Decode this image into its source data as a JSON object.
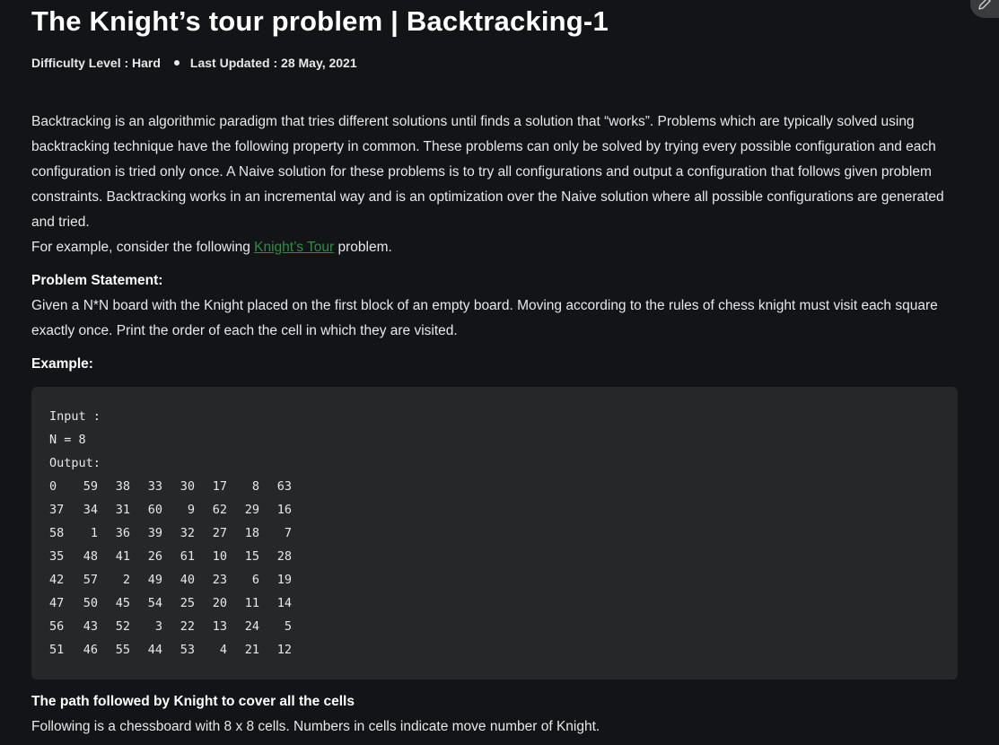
{
  "article": {
    "title": "The Knight’s tour problem | Backtracking-1",
    "difficulty_label": "Difficulty Level : Hard",
    "updated_label": "Last Updated : 28 May, 2021",
    "intro_paragraph": "Backtracking is an algorithmic paradigm that tries different solutions until finds a solution that “works”. Problems which are typically solved using backtracking technique have the following property in common. These problems can only be solved by trying every possible configuration and each configuration is tried only once. A Naive solution for these problems is to try all configurations and output a configuration that follows given problem constraints. Backtracking works in an incremental way and is an optimization over the Naive solution where all possible configurations are generated and tried.",
    "example_prefix": "For example, consider the following ",
    "example_link": "Knight’s Tour",
    "example_suffix": " problem.",
    "problem_heading": "Problem Statement:",
    "problem_text": "Given a N*N board with the Knight placed on the first block of an empty board. Moving according to the rules of chess knight must visit each square exactly once. Print the order of each the cell in which they are visited.",
    "example_heading": "Example:",
    "path_heading": "The path followed by Knight to cover all the cells",
    "path_text": "Following is a chessboard with 8 x 8 cells. Numbers in cells indicate move number of Knight."
  },
  "code": {
    "input_label": "Input :",
    "n_line": "N = 8",
    "output_label": "Output:",
    "board": [
      [
        "0",
        "59",
        "38",
        "33",
        "30",
        "17",
        "8",
        "63"
      ],
      [
        "37",
        "34",
        "31",
        "60",
        "9",
        "62",
        "29",
        "16"
      ],
      [
        "58",
        "1",
        "36",
        "39",
        "32",
        "27",
        "18",
        "7"
      ],
      [
        "35",
        "48",
        "41",
        "26",
        "61",
        "10",
        "15",
        "28"
      ],
      [
        "42",
        "57",
        "2",
        "49",
        "40",
        "23",
        "6",
        "19"
      ],
      [
        "47",
        "50",
        "45",
        "54",
        "25",
        "20",
        "11",
        "14"
      ],
      [
        "56",
        "43",
        "52",
        "3",
        "22",
        "13",
        "24",
        "5"
      ],
      [
        "51",
        "46",
        "55",
        "44",
        "53",
        "4",
        "21",
        "12"
      ]
    ]
  },
  "icons": {
    "edit": "pencil-icon"
  },
  "colors": {
    "background": "#131417",
    "code_background": "#262729",
    "link": "#2f8d46",
    "text": "#e8e8e8"
  }
}
